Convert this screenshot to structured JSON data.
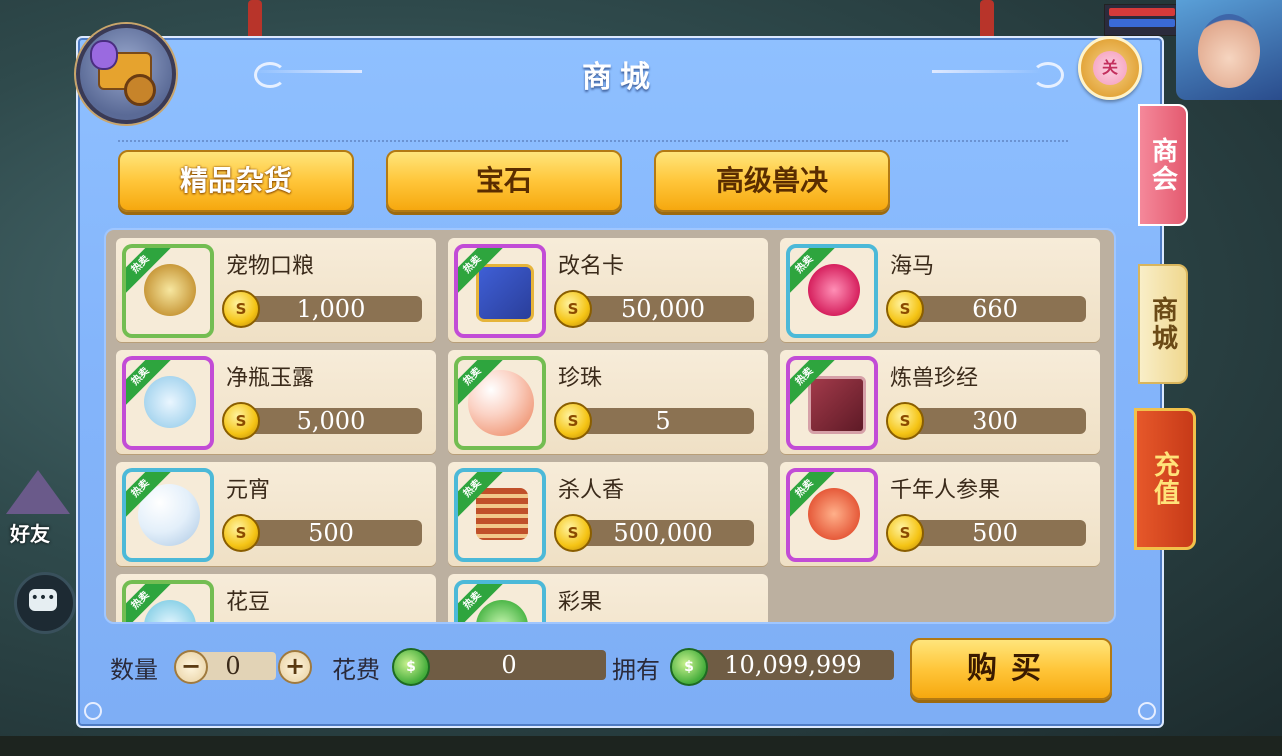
{
  "shop": {
    "title": "商城",
    "close_label": "关",
    "categories": [
      "精品杂货",
      "宝石",
      "高级兽决"
    ],
    "hot_tag": "热卖",
    "coin_glyph": "S",
    "items": [
      {
        "name": "宠物口粮",
        "price": "1,000",
        "frame": "green"
      },
      {
        "name": "改名卡",
        "price": "50,000",
        "frame": "purple"
      },
      {
        "name": "海马",
        "price": "660",
        "frame": "blue"
      },
      {
        "name": "净瓶玉露",
        "price": "5,000",
        "frame": "purple"
      },
      {
        "name": "珍珠",
        "price": "5",
        "frame": "green"
      },
      {
        "name": "炼兽珍经",
        "price": "300",
        "frame": "purple"
      },
      {
        "name": "元宵",
        "price": "500",
        "frame": "blue"
      },
      {
        "name": "杀人香",
        "price": "500,000",
        "frame": "blue"
      },
      {
        "name": "千年人参果",
        "price": "500",
        "frame": "purple"
      },
      {
        "name": "花豆",
        "price": "",
        "frame": "green"
      },
      {
        "name": "彩果",
        "price": "",
        "frame": "blue"
      }
    ],
    "bottom": {
      "quantity_label": "数量",
      "quantity_value": "0",
      "cost_label": "花费",
      "cost_value": "0",
      "owned_label": "拥有",
      "owned_value": "10,099,999",
      "buy_label": "购买"
    },
    "side_tabs": [
      "商会",
      "商城",
      "充值"
    ]
  },
  "background": {
    "friends_label": "好友"
  },
  "colors": {
    "panel_blue": "#84b5fb",
    "button_gold": "#ffc63a",
    "item_card": "#f7ecd9",
    "price_brown": "#8b7252",
    "frame_green": "#73bd52",
    "frame_purple": "#c24cd6",
    "frame_blue": "#4cb9d8"
  }
}
